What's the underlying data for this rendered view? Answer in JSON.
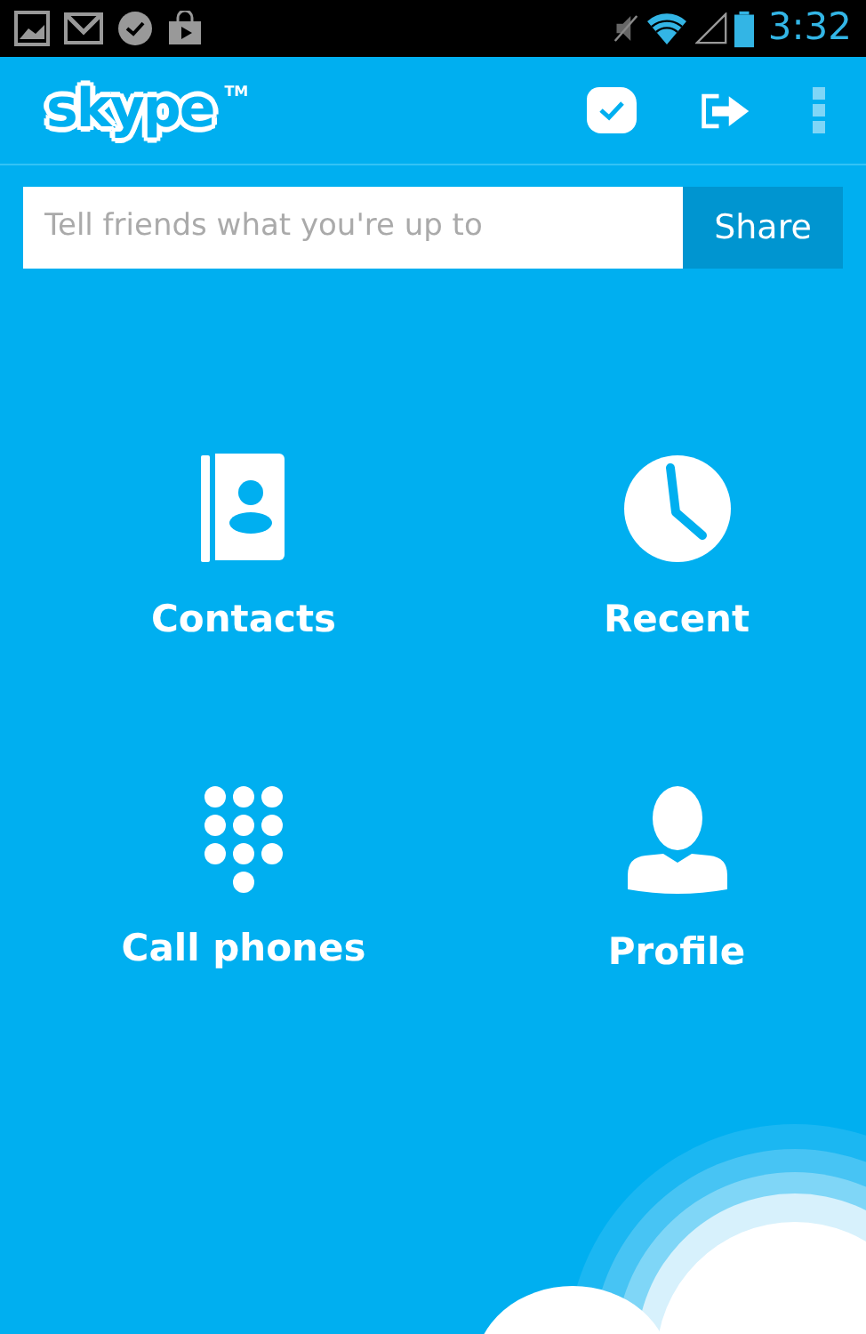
{
  "status_bar": {
    "time": "3:32"
  },
  "header": {
    "logo": "skype",
    "logo_mark": "TM"
  },
  "mood": {
    "placeholder": "Tell friends what you're up to",
    "button": "Share"
  },
  "tiles": [
    {
      "kind": "contacts",
      "label": "Contacts"
    },
    {
      "kind": "recent",
      "label": "Recent"
    },
    {
      "kind": "dialpad",
      "label": "Call phones"
    },
    {
      "kind": "profile",
      "label": "Profile"
    }
  ]
}
